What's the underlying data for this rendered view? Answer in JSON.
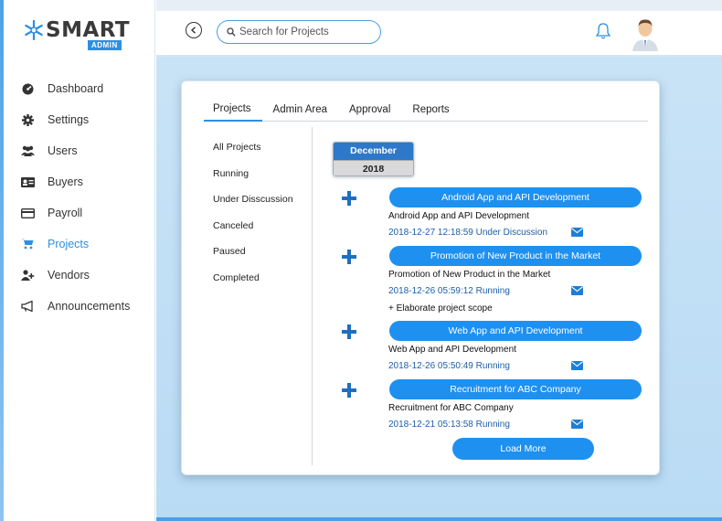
{
  "brand": {
    "word": "SMART",
    "sub": "ADMIN"
  },
  "sidebar": {
    "items": [
      {
        "label": "Dashboard",
        "icon": "dashboard-icon"
      },
      {
        "label": "Settings",
        "icon": "gear-icon"
      },
      {
        "label": "Users",
        "icon": "users-icon"
      },
      {
        "label": "Buyers",
        "icon": "id-card-icon"
      },
      {
        "label": "Payroll",
        "icon": "credit-card-icon"
      },
      {
        "label": "Projects",
        "icon": "cart-icon",
        "active": true
      },
      {
        "label": "Vendors",
        "icon": "user-plus-icon"
      },
      {
        "label": "Announcements",
        "icon": "megaphone-icon"
      }
    ]
  },
  "header": {
    "search_placeholder": "Search for Projects"
  },
  "tabs": [
    "Projects",
    "Admin Area",
    "Approval",
    "Reports"
  ],
  "filters": [
    "All Projects",
    "Running",
    "Under Disscussion",
    "Canceled",
    "Paused",
    "Completed"
  ],
  "calendar": {
    "month": "December",
    "year": "2018"
  },
  "projects": [
    {
      "title": "Android App and API Development",
      "name": "Android App and API Development",
      "meta": "2018-12-27 12:18:59 Under Discussion",
      "extra": ""
    },
    {
      "title": "Promotion of New Product in the Market",
      "name": "Promotion of New Product in the Market",
      "meta": "2018-12-26 05:59:12 Running",
      "extra": "+ Elaborate project scope"
    },
    {
      "title": "Web App and API Development",
      "name": "Web App and API Development",
      "meta": "2018-12-26 05:50:49 Running",
      "extra": ""
    },
    {
      "title": "Recruitment for ABC Company",
      "name": "Recruitment for ABC Company",
      "meta": "2018-12-21 05:13:58 Running",
      "extra": ""
    }
  ],
  "load_more_label": "Load More",
  "colors": {
    "accent": "#1e90f0",
    "calendar_header": "#2d78c8",
    "background": "#c9e3f6",
    "link": "#1d5ea8"
  }
}
